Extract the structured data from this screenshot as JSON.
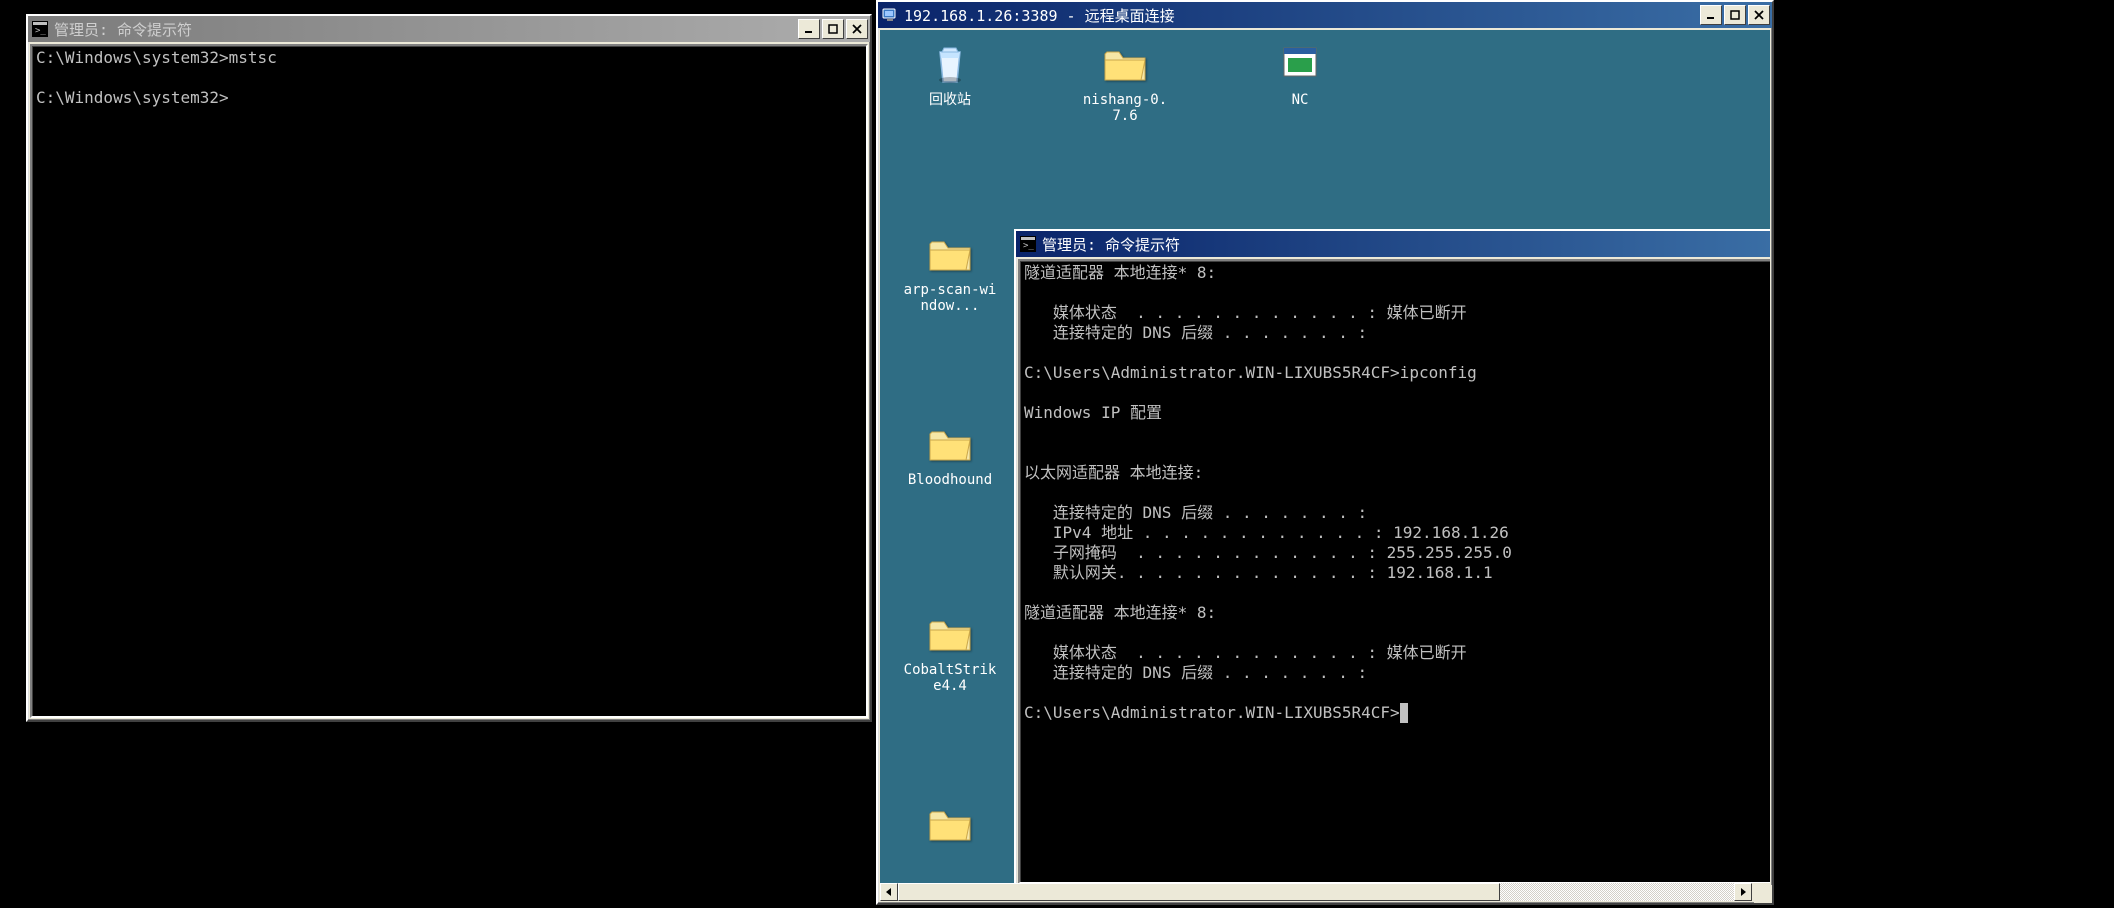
{
  "left_cmd": {
    "title": "管理员: 命令提示符",
    "lines": [
      "C:\\Windows\\system32>mstsc",
      "",
      "C:\\Windows\\system32>"
    ]
  },
  "rdp": {
    "title": "192.168.1.26:3389 - 远程桌面连接",
    "desktop_icons": [
      {
        "id": "recycle-bin",
        "label": "回收站",
        "kind": "recycle"
      },
      {
        "id": "nishang",
        "label": "nishang-0.7.6",
        "kind": "folder"
      },
      {
        "id": "nc",
        "label": "NC",
        "kind": "app"
      },
      {
        "id": "arpscan",
        "label": "arp-scan-window...",
        "kind": "folder"
      },
      {
        "id": "bloodhound",
        "label": "Bloodhound",
        "kind": "folder"
      },
      {
        "id": "cobalt",
        "label": "CobaltStrike4.4",
        "kind": "folder"
      },
      {
        "id": "extra",
        "label": "",
        "kind": "folder"
      }
    ],
    "inner_cmd": {
      "title": "管理员: 命令提示符",
      "lines": [
        "隧道适配器 本地连接* 8:",
        "",
        "   媒体状态  . . . . . . . . . . . . : 媒体已断开",
        "   连接特定的 DNS 后缀 . . . . . . . :",
        "",
        "C:\\Users\\Administrator.WIN-LIXUBS5R4CF>ipconfig",
        "",
        "Windows IP 配置",
        "",
        "",
        "以太网适配器 本地连接:",
        "",
        "   连接特定的 DNS 后缀 . . . . . . . :",
        "   IPv4 地址 . . . . . . . . . . . . : 192.168.1.26",
        "   子网掩码  . . . . . . . . . . . . : 255.255.255.0",
        "   默认网关. . . . . . . . . . . . . : 192.168.1.1",
        "",
        "隧道适配器 本地连接* 8:",
        "",
        "   媒体状态  . . . . . . . . . . . . : 媒体已断开",
        "   连接特定的 DNS 后缀 . . . . . . . :",
        "",
        "C:\\Users\\Administrator.WIN-LIXUBS5R4CF>"
      ]
    }
  }
}
